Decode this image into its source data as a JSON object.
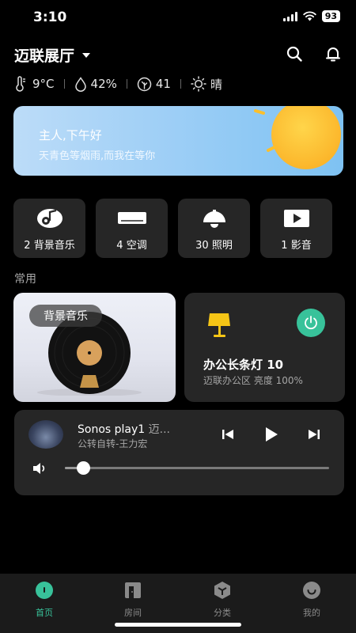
{
  "status_bar": {
    "time": "3:10",
    "battery": "93"
  },
  "header": {
    "home_name": "迈联展厅"
  },
  "weather": {
    "temperature": "9°C",
    "humidity": "42%",
    "air_quality": "41",
    "condition": "晴"
  },
  "banner": {
    "greeting": "主人,下午好",
    "subtitle": "天青色等烟雨,而我在等你"
  },
  "categories": [
    {
      "label": "2 背景音乐",
      "icon": "music-icon"
    },
    {
      "label": "4 空调",
      "icon": "air-conditioner-icon"
    },
    {
      "label": "30 照明",
      "icon": "lamp-icon"
    },
    {
      "label": "1 影音",
      "icon": "play-icon"
    }
  ],
  "section": {
    "common_title": "常用"
  },
  "music_card": {
    "label": "背景音乐"
  },
  "lamp_card": {
    "name": "办公长条灯 10",
    "detail": "迈联办公区 亮度 100%"
  },
  "player": {
    "device": "Sonos play1",
    "room": "迈...",
    "track": "公转自转-王力宏",
    "volume": 0.07
  },
  "colors": {
    "accent": "#38c29a",
    "card": "#262626",
    "lamp_yellow": "#f5c516",
    "sun": "#fcbf2b"
  },
  "tabs": [
    {
      "label": "首页",
      "icon": "home-icon",
      "active": true
    },
    {
      "label": "房间",
      "icon": "room-icon",
      "active": false
    },
    {
      "label": "分类",
      "icon": "category-icon",
      "active": false
    },
    {
      "label": "我的",
      "icon": "profile-icon",
      "active": false
    }
  ]
}
